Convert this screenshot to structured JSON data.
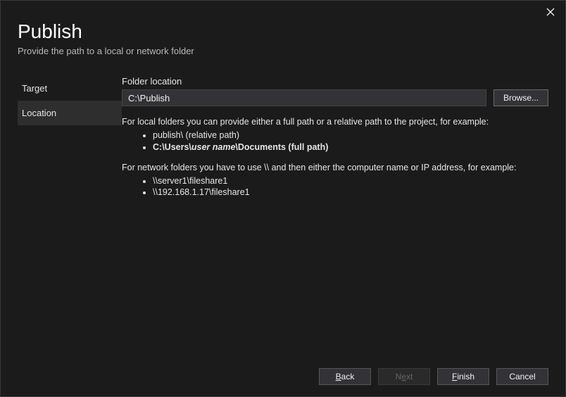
{
  "header": {
    "title": "Publish",
    "subtitle": "Provide the path to a local or network folder"
  },
  "sidebar": {
    "items": [
      {
        "label": "Target",
        "selected": false
      },
      {
        "label": "Location",
        "selected": true
      }
    ]
  },
  "main": {
    "folder_label": "Folder location",
    "folder_value": "C:\\Publish",
    "browse_label": "Browse...",
    "help_local_intro": "For local folders you can provide either a full path or a relative path to the project, for example:",
    "help_local_ex1": "publish\\ (relative path)",
    "help_local_ex2_prefix": "C:\\Users\\",
    "help_local_ex2_italic": "user name",
    "help_local_ex2_suffix": "\\Documents (full path)",
    "help_net_intro": "For network folders you have to use \\\\ and then either the computer name or IP address, for example:",
    "help_net_ex1": "\\\\server1\\fileshare1",
    "help_net_ex2": "\\\\192.168.1.17\\fileshare1"
  },
  "footer": {
    "back": "Back",
    "next": "Next",
    "finish": "Finish",
    "cancel": "Cancel"
  }
}
